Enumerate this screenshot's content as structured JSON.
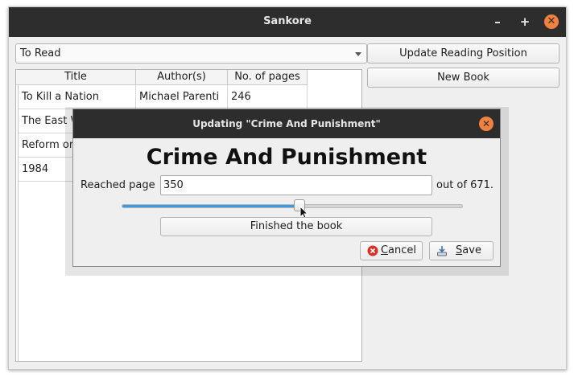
{
  "window": {
    "title": "Sankore"
  },
  "list_filter": {
    "selected": "To Read"
  },
  "buttons": {
    "update_position": "Update Reading Position",
    "new_book": "New Book"
  },
  "table": {
    "columns": [
      "Title",
      "Author(s)",
      "No. of pages"
    ],
    "rows": [
      {
        "title": "To Kill a Nation",
        "author": "Michael Parenti",
        "pages": "246"
      },
      {
        "title": "The East W",
        "author": "",
        "pages": ""
      },
      {
        "title": "Reform or",
        "author": "",
        "pages": ""
      },
      {
        "title": "1984",
        "author": "",
        "pages": ""
      }
    ]
  },
  "dialog": {
    "title": "Updating \"Crime And Punishment\"",
    "book_title": "Crime And Punishment",
    "reached_label": "Reached page",
    "page_value": "350",
    "out_of_label": "out of 671.",
    "slider": {
      "min": 0,
      "max": 671,
      "value": 350
    },
    "finished_label": "Finished the book",
    "cancel_first": "C",
    "cancel_rest": "ancel",
    "save_first": "S",
    "save_rest": "ave"
  },
  "colors": {
    "accent": "#3c9ae0",
    "titlebar": "#2d2d2d",
    "close_button": "#f0813f"
  }
}
